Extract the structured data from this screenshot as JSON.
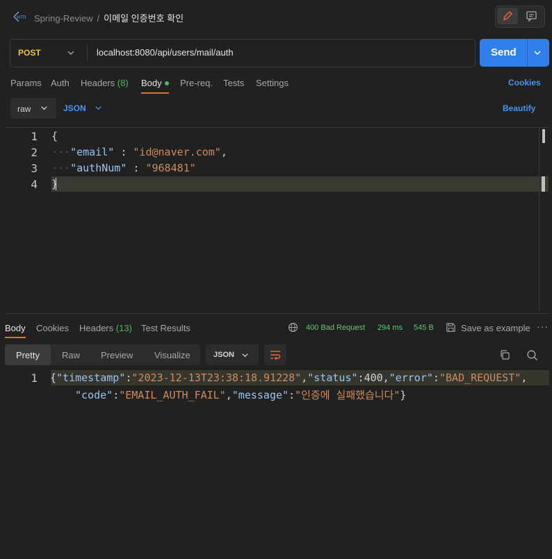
{
  "header": {
    "workspace": "Spring-Review",
    "separator": "/",
    "request_name": "이메일 인증번호 확인"
  },
  "request": {
    "method": "POST",
    "url": "localhost:8080/api/users/mail/auth",
    "send_label": "Send"
  },
  "request_tabs": {
    "params": "Params",
    "auth": "Auth",
    "headers": "Headers",
    "headers_count": "(8)",
    "body": "Body",
    "prereq": "Pre-req.",
    "tests": "Tests",
    "settings": "Settings",
    "cookies": "Cookies"
  },
  "body_options": {
    "mode": "raw",
    "language": "JSON",
    "beautify": "Beautify"
  },
  "editor": {
    "line_numbers": [
      "1",
      "2",
      "3",
      "4"
    ],
    "open_brace": "{",
    "close_brace": "}",
    "line2": {
      "key": "\"email\"",
      "sep": " : ",
      "value": "\"id@naver.com\"",
      "trail": ","
    },
    "line3": {
      "key": "\"authNum\"",
      "sep": " : ",
      "value": "\"968481\""
    }
  },
  "response_tabs": {
    "body": "Body",
    "cookies": "Cookies",
    "headers": "Headers",
    "headers_count": "(13)",
    "test_results": "Test Results"
  },
  "response_meta": {
    "status": "400 Bad Request",
    "time": "294 ms",
    "size": "545 B",
    "save_label": "Save as example",
    "more": "···"
  },
  "response_toolbar": {
    "views": [
      "Pretty",
      "Raw",
      "Preview",
      "Visualize"
    ],
    "format": "JSON"
  },
  "response_body": {
    "line_number": "1",
    "line1": {
      "open": "{",
      "k1": "\"timestamp\"",
      "v1": "\"2023-12-13T23:38:18.91228\"",
      "k2": "\"status\"",
      "v2": "400",
      "k3": "\"error\"",
      "v3": "\"BAD_REQUEST\"",
      "trail": ","
    },
    "line2": {
      "k4": "\"code\"",
      "v4": "\"EMAIL_AUTH_FAIL\"",
      "k5": "\"message\"",
      "v5": "\"인증에 실패했습니다\"",
      "close": "}"
    }
  },
  "colors": {
    "background": "#212121",
    "accent_blue": "#2f80ed",
    "tab_underline": "#f26b3a",
    "method_yellow": "#e8c547",
    "status_green": "#5cc879"
  }
}
